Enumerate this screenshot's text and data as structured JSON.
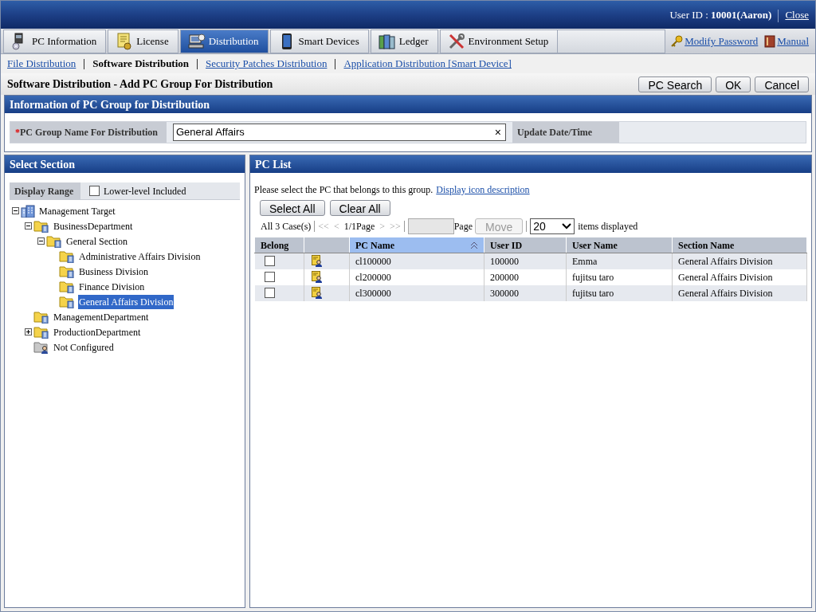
{
  "header": {
    "user_label": "User ID :",
    "user_id": "10001(Aaron)",
    "close": "Close"
  },
  "tabs": [
    {
      "label": "PC Information",
      "kind": "pc",
      "selected": false
    },
    {
      "label": "License",
      "kind": "license",
      "selected": false
    },
    {
      "label": "Distribution",
      "kind": "distribution",
      "selected": true
    },
    {
      "label": "Smart Devices",
      "kind": "phone",
      "selected": false
    },
    {
      "label": "Ledger",
      "kind": "ledger",
      "selected": false
    },
    {
      "label": "Environment Setup",
      "kind": "tools",
      "selected": false
    }
  ],
  "right_links": [
    {
      "label": "Modify Password",
      "kind": "key"
    },
    {
      "label": "Manual",
      "kind": "book"
    }
  ],
  "subnav": [
    {
      "label": "File Distribution",
      "selected": false
    },
    {
      "label": "Software Distribution",
      "selected": true
    },
    {
      "label": "Security Patches Distribution",
      "selected": false
    },
    {
      "label": "Application Distribution [Smart Device]",
      "selected": false
    }
  ],
  "page_title": "Software Distribution - Add PC Group For Distribution",
  "buttons": [
    "PC Search",
    "OK",
    "Cancel"
  ],
  "info_panel": {
    "title": "Information of PC Group for Distribution",
    "required_mark": "*",
    "field_label": "PC Group Name For Distribution",
    "value": "General Affairs",
    "clear": "×",
    "update_label": "Update Date/Time"
  },
  "section_panel": {
    "title": "Select Section",
    "range_label": "Display Range",
    "lower_level": {
      "label": "Lower-level Included",
      "checked": false
    },
    "tree": [
      {
        "label": "Management Target",
        "kind": "root",
        "expanded": true,
        "selected": false,
        "children": [
          {
            "label": "BusinessDepartment",
            "kind": "folder",
            "expanded": true,
            "selected": false,
            "children": [
              {
                "label": "General Section",
                "kind": "folder",
                "expanded": true,
                "selected": false,
                "children": [
                  {
                    "label": "Administrative Affairs Division",
                    "kind": "folder",
                    "selected": false
                  },
                  {
                    "label": "Business Division",
                    "kind": "folder",
                    "selected": false
                  },
                  {
                    "label": "Finance Division",
                    "kind": "folder",
                    "selected": false
                  },
                  {
                    "label": "General Affairs Division",
                    "kind": "folder",
                    "selected": true
                  }
                ]
              }
            ]
          },
          {
            "label": "ManagementDepartment",
            "kind": "folder",
            "selected": false
          },
          {
            "label": "ProductionDepartment",
            "kind": "folder",
            "expanded": false,
            "selected": false
          },
          {
            "label": "Not Configured",
            "kind": "unassigned",
            "selected": false
          }
        ]
      }
    ]
  },
  "pc_list": {
    "title": "PC List",
    "instruction": "Please select the PC that belongs to this group.",
    "link": "Display icon description",
    "select_all": "Select All",
    "clear_all": "Clear All",
    "pager": {
      "count": "All 3 Case(s)",
      "first": "<<",
      "prev": "<",
      "page": "1/1Page",
      "next": ">",
      "last": ">>",
      "page_label": "Page",
      "move": "Move",
      "per_page": "20",
      "items_label": "items displayed"
    },
    "columns": [
      {
        "label": "Belong",
        "sorted": false
      },
      {
        "sorted": false
      },
      {
        "label": "PC Name",
        "sorted": true
      },
      {
        "label": "User ID",
        "sorted": false
      },
      {
        "label": "User Name",
        "sorted": false
      },
      {
        "label": "Section Name",
        "sorted": false
      }
    ],
    "rows": [
      {
        "belong": false,
        "pc_name": "cl100000",
        "user_id": "100000",
        "user_name": "Emma",
        "section": "General Affairs Division"
      },
      {
        "belong": false,
        "pc_name": "cl200000",
        "user_id": "200000",
        "user_name": "fujitsu taro",
        "section": "General Affairs Division"
      },
      {
        "belong": false,
        "pc_name": "cl300000",
        "user_id": "300000",
        "user_name": "fujitsu taro",
        "section": "General Affairs Division"
      }
    ]
  }
}
